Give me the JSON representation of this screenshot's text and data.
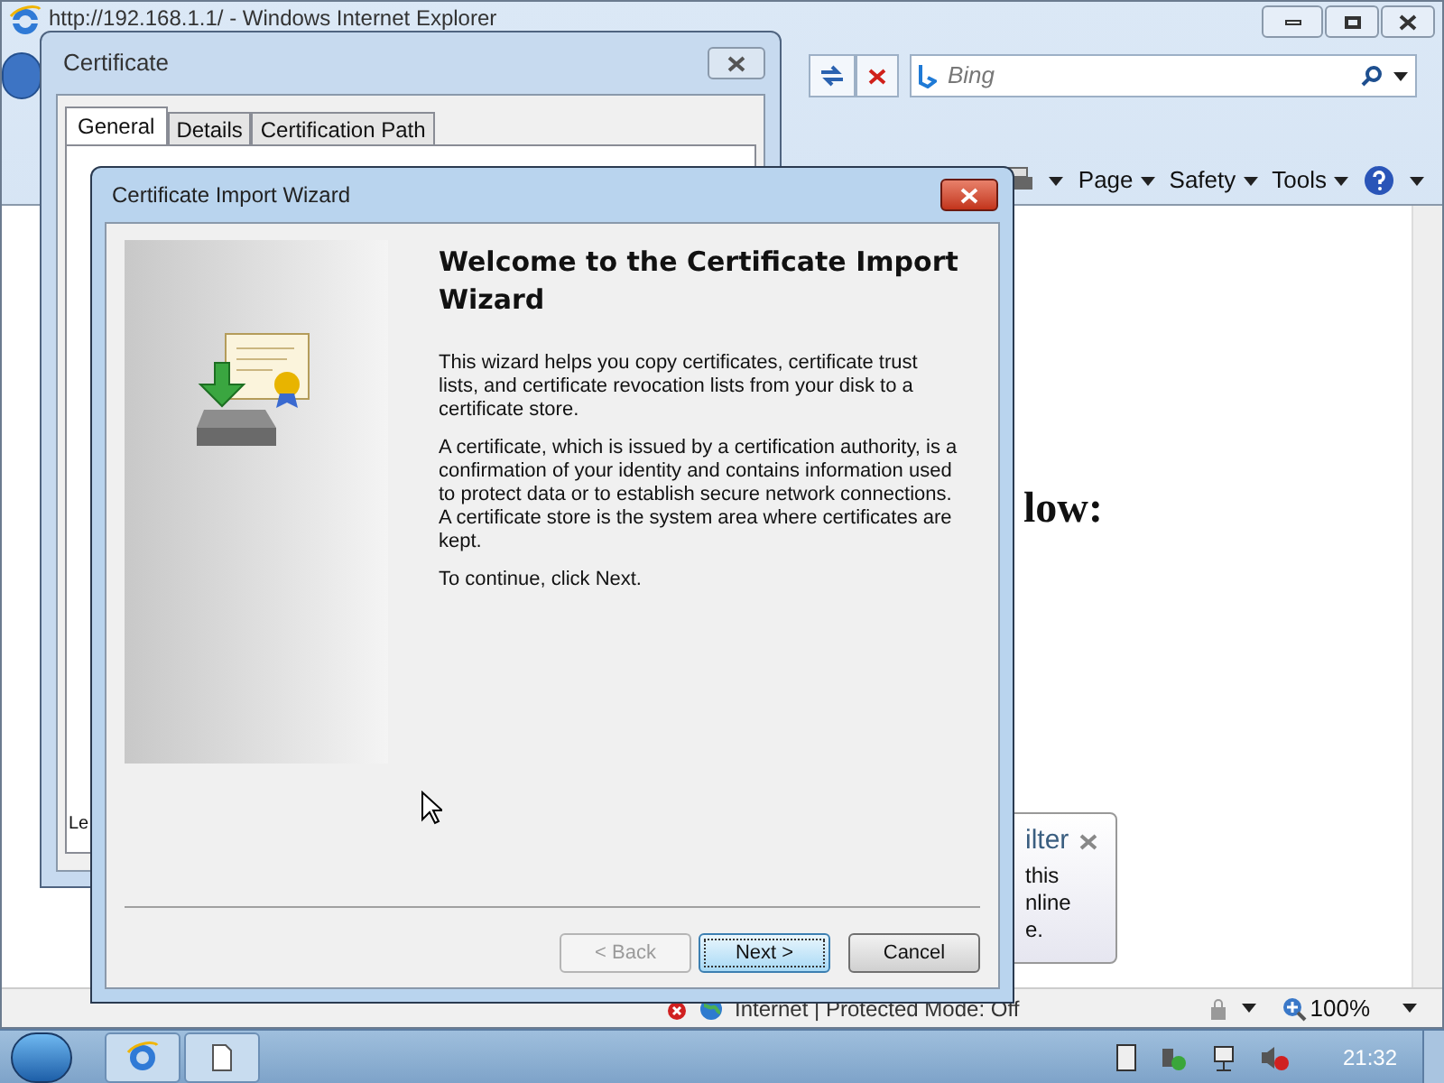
{
  "browser": {
    "title": "http://192.168.1.1/ - Windows Internet Explorer",
    "search": {
      "placeholder": "Bing"
    },
    "menus": [
      {
        "label": "Page"
      },
      {
        "label": "Safety"
      },
      {
        "label": "Tools"
      }
    ],
    "page_heading": "low:",
    "notification": {
      "title": "ilter",
      "lines": [
        "this",
        "nline",
        "e."
      ]
    },
    "status": {
      "zone": "Internet | Protected Mode: Off",
      "zoom": "100%"
    }
  },
  "certificate_dialog": {
    "title": "Certificate",
    "tabs": [
      {
        "label": "General",
        "selected": true
      },
      {
        "label": "Details",
        "selected": false
      },
      {
        "label": "Certification Path",
        "selected": false
      }
    ],
    "footer_text": "Le"
  },
  "wizard": {
    "title": "Certificate Import Wizard",
    "heading": "Welcome to the Certificate Import Wizard",
    "paragraphs": [
      "This wizard helps you copy certificates, certificate trust lists, and certificate revocation lists from your disk to a certificate store.",
      "A certificate, which is issued by a certification authority, is a confirmation of your identity and contains information used to protect data or to establish secure network connections. A certificate store is the system area where certificates are kept.",
      "To continue, click Next."
    ],
    "buttons": [
      {
        "label": "< Back",
        "disabled": true,
        "default": false
      },
      {
        "label": "Next >",
        "disabled": false,
        "default": true
      },
      {
        "label": "Cancel",
        "disabled": false,
        "default": false
      }
    ]
  },
  "taskbar": {
    "clock": "21:32"
  }
}
